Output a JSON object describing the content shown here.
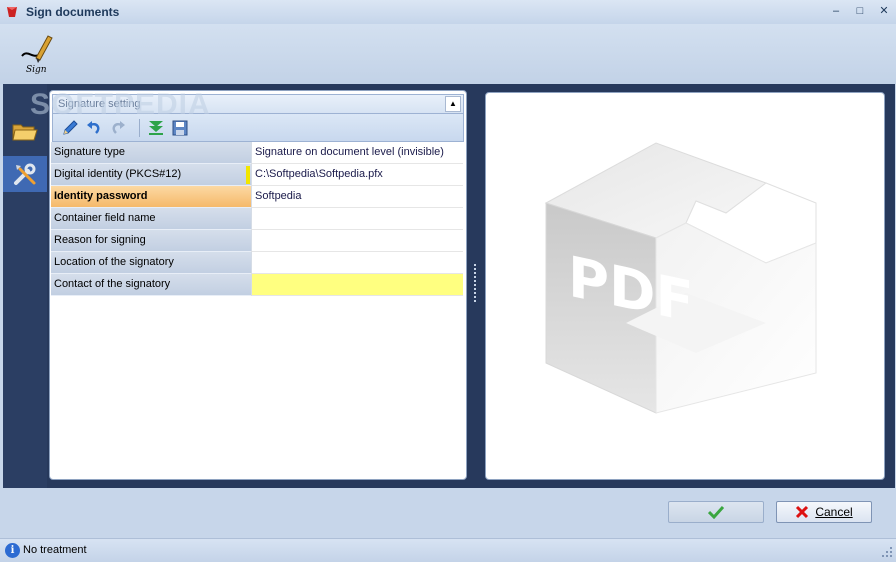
{
  "window": {
    "title": "Sign documents"
  },
  "watermark": "SOFTPEDIA",
  "properties": {
    "section_label": "Signature setting",
    "rows": [
      {
        "name": "Signature type",
        "value": "Signature on document level (invisible)"
      },
      {
        "name": "Digital identity (PKCS#12)",
        "value": "C:\\Softpedia\\Softpedia.pfx"
      },
      {
        "name": "Identity password",
        "value": "Softpedia"
      },
      {
        "name": "Container field name",
        "value": ""
      },
      {
        "name": "Reason for signing",
        "value": ""
      },
      {
        "name": "Location of the signatory",
        "value": ""
      },
      {
        "name": "Contact of the signatory",
        "value": ""
      }
    ]
  },
  "preview": {
    "label": "PDF"
  },
  "buttons": {
    "cancel_label": "Cancel"
  },
  "status": {
    "text": "No treatment"
  },
  "colors": {
    "accent": "#3f69b3",
    "selected_row": "#f5b96a",
    "highlight": "#ffff80"
  },
  "icons": {
    "app": "app-icon",
    "sign": "sign-pen-icon",
    "open": "folder-open-icon",
    "tools": "tools-icon",
    "edit": "pencil-icon",
    "undo": "undo-icon",
    "redo": "redo-icon",
    "down": "download-arrows-icon",
    "save": "floppy-icon",
    "ok": "checkmark-icon",
    "cancel": "red-x-icon",
    "info": "info-icon"
  }
}
